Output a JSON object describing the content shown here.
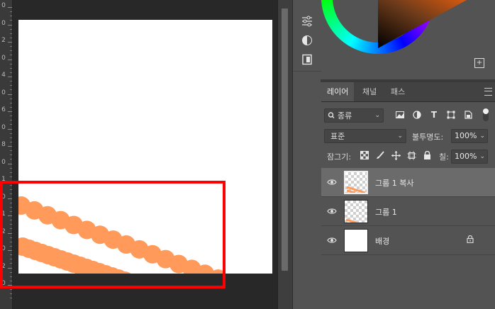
{
  "ruler": {
    "labels": [
      "0",
      "0",
      "2",
      "0",
      "4",
      "0",
      "6",
      "0",
      "8",
      "0",
      "1",
      "0",
      "1",
      "2",
      "0",
      "2",
      "0"
    ]
  },
  "layers_panel": {
    "tabs": [
      {
        "label": "레이어",
        "active": true
      },
      {
        "label": "채널",
        "active": false
      },
      {
        "label": "패스",
        "active": false
      }
    ],
    "filter": {
      "value": "종류"
    },
    "blend_mode": {
      "value": "표준"
    },
    "opacity": {
      "label": "불투명도:",
      "value": "100%"
    },
    "lock": {
      "label": "잠그기:"
    },
    "fill": {
      "label": "칠:",
      "value": "100%"
    },
    "layers": [
      {
        "name": "그룹 1 복사",
        "visible": true,
        "selected": true,
        "thumbnail": "transparent-with-stroke"
      },
      {
        "name": "그룹 1",
        "visible": true,
        "selected": false,
        "thumbnail": "transparent-with-stroke"
      },
      {
        "name": "배경",
        "visible": true,
        "selected": false,
        "thumbnail": "white",
        "locked": true
      }
    ]
  },
  "tools": [
    {
      "icon": "adjustments-sliders-icon",
      "glyph": "☰"
    },
    {
      "icon": "color-adjust-icon",
      "glyph": "◐"
    },
    {
      "icon": "libraries-icon",
      "glyph": "▣"
    }
  ],
  "colors": {
    "accent_highlight": "#ff0000",
    "stroke": "#ff9a5a",
    "panel_bg": "#535353",
    "workspace_bg": "#282828"
  }
}
